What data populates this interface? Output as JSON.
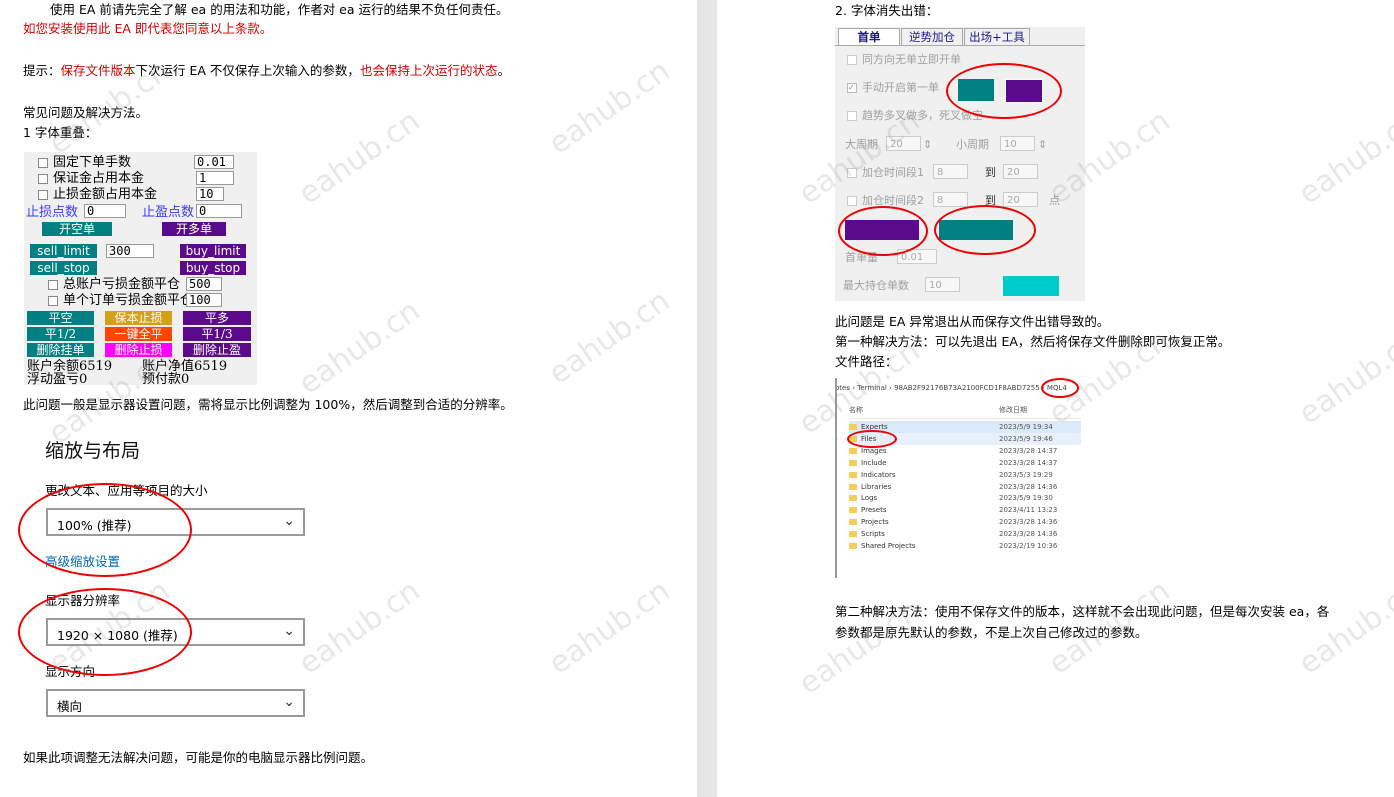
{
  "left": {
    "line1": "使用 EA 前请先完全了解 ea 的用法和功能，作者对 ea 运行的结果不负任何责任。",
    "line2": "如您安装使用此 EA 即代表您同意以上条款。",
    "tip_prefix": "提示：",
    "tip_red1": "保存文件版本",
    "tip_mid": "下次运行 EA 不仅保存上次输入的参数，",
    "tip_red2": "也会保持上次运行的状态",
    "tip_end": "。",
    "faq_title": "常见问题及解决方法。",
    "issue1": "1 字体重叠：",
    "panel1": {
      "row1": "固定下单手数",
      "row1_val": "0.01",
      "row2": "保证金占用本金",
      "row2_val": "1",
      "row3": "止损金额占用本金",
      "row3_val": "10",
      "sl_label": "止损点数",
      "sl_val": "0",
      "tp_label": "止盈点数",
      "tp_val": "0",
      "open_short": "开空单",
      "open_long": "开多单",
      "sell_limit": "sell_limit",
      "limit_val": "300",
      "buy_limit": "buy_limit",
      "sell_stop": "sell_stop",
      "buy_stop": "buy_stop",
      "row_acc": "总账户亏损金额平仓",
      "row_acc_val": "500",
      "row_single": "单个订单亏损金额平仓",
      "row_single_val": "100",
      "close_short": "平空",
      "breakeven": "保本止损",
      "close_long": "平多",
      "half": "平1/2",
      "one_key": "一键全平",
      "third": "平1/3",
      "del_pending": "删除挂单",
      "del_sl": "删除止损",
      "del_tp": "删除止盈",
      "balance_label": "账户余额",
      "balance_val": "6519",
      "equity_label": "账户净值",
      "equity_val": "6519",
      "float_label": "浮动盈亏",
      "float_val": "0",
      "prepaid_label": "预付款",
      "prepaid_val": "0"
    },
    "issue1_desc": "此问题一般是显示器设置问题，需将显示比例调整为 100%，然后调整到合适的分辨率。",
    "settings": {
      "title": "缩放与布局",
      "size_label": "更改文本、应用等项目的大小",
      "size_value": "100% (推荐)",
      "advanced_link": "高级缩放设置",
      "res_label": "显示器分辨率",
      "res_value": "1920 × 1080 (推荐)",
      "orient_label": "显示方向",
      "orient_value": "横向"
    },
    "footer": "如果此项调整无法解决问题，可能是你的电脑显示器比例问题。"
  },
  "right": {
    "issue2": "2.  字体消失出错：",
    "panel2": {
      "tabs": [
        "首单",
        "逆势加仓",
        "出场+工具"
      ],
      "opt1": "同方向无单立即开单",
      "opt2": "手动开启第一单",
      "opt3": "趋势多叉做多，死叉做空",
      "big_period": "大周期",
      "big_val": "20",
      "small_period": "小周期",
      "small_val": "10",
      "add_interval1": "加仓时间段1",
      "ai1_from": "8",
      "to1": "到",
      "ai1_to": "20",
      "add_interval2": "加仓时间段2",
      "ai2_from": "8",
      "to2": "到",
      "ai2_to": "20",
      "unit": "点",
      "first_lot": "首单量",
      "first_lot_val": "0.01",
      "max_orders": "最大持仓单数",
      "max_orders_val": "10"
    },
    "desc1": "此问题是 EA 异常退出从而保存文件出错导致的。",
    "desc2": "第一种解决方法：可以先退出 EA，然后将保存文件删除即可恢复正常。",
    "path_label": "文件路径：",
    "explorer": {
      "breadcrumb": [
        "otes",
        "Terminal",
        "98AB2F92176B73A2100FCD1F8ABD7255",
        "MQL4"
      ],
      "col_name": "名称",
      "col_date": "修改日期",
      "rows": [
        {
          "name": "Experts",
          "date": "2023/5/9 19:34"
        },
        {
          "name": "Files",
          "date": "2023/5/9 19:46"
        },
        {
          "name": "Images",
          "date": "2023/3/28 14:37"
        },
        {
          "name": "Include",
          "date": "2023/3/28 14:37"
        },
        {
          "name": "Indicators",
          "date": "2023/5/3 19:29"
        },
        {
          "name": "Libraries",
          "date": "2023/3/28 14:36"
        },
        {
          "name": "Logs",
          "date": "2023/5/9 19:30"
        },
        {
          "name": "Presets",
          "date": "2023/4/11 13:23"
        },
        {
          "name": "Projects",
          "date": "2023/3/28 14:36"
        },
        {
          "name": "Scripts",
          "date": "2023/3/28 14:36"
        },
        {
          "name": "Shared Projects",
          "date": "2023/2/19 10:36"
        }
      ]
    },
    "desc3": "第二种解决方法：使用不保存文件的版本，这样就不会出现此问题，但是每次安装 ea，各",
    "desc4": "参数都是原先默认的参数，不是上次自己修改过的参数。"
  },
  "watermark": "eahub.cn",
  "colors": {
    "teal": "#008080",
    "purple": "#5a0a8a",
    "cyan": "#00cccc",
    "red_ring": "#ee0000",
    "text_red": "#d00000"
  }
}
